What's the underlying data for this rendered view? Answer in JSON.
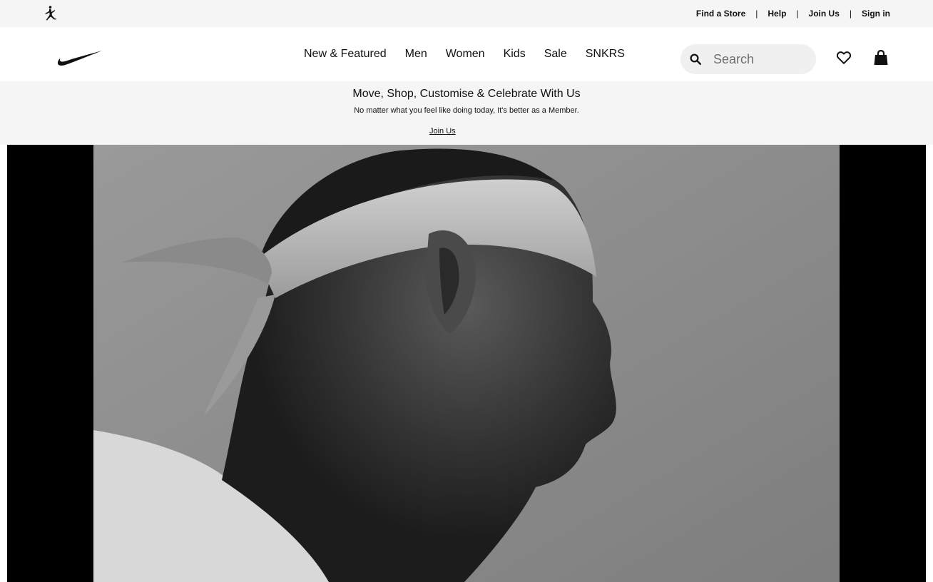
{
  "utility_bar": {
    "logo_icon": "jordan-jumpman-icon",
    "links": [
      "Find a Store",
      "Help",
      "Join Us",
      "Sign in"
    ],
    "separator": "|"
  },
  "nav": {
    "logo_icon": "nike-swoosh-icon",
    "menu": [
      "New & Featured",
      "Men",
      "Women",
      "Kids",
      "Sale",
      "SNKRS"
    ],
    "search": {
      "placeholder": "Search",
      "icon": "search-icon"
    },
    "favorites_icon": "heart-icon",
    "bag_icon": "shopping-bag-icon"
  },
  "promo": {
    "title": "Move, Shop, Customise & Celebrate With Us",
    "subtitle": "No matter what you feel like doing today, It's better as a Member.",
    "link": "Join Us"
  },
  "hero": {
    "media": "black-and-white-athlete-with-headband-video",
    "letterbox_color": "#000000"
  },
  "colors": {
    "text": "#111111",
    "utility_bg": "#f5f5f5",
    "search_bg": "#f0f0f0",
    "placeholder": "#707072"
  }
}
